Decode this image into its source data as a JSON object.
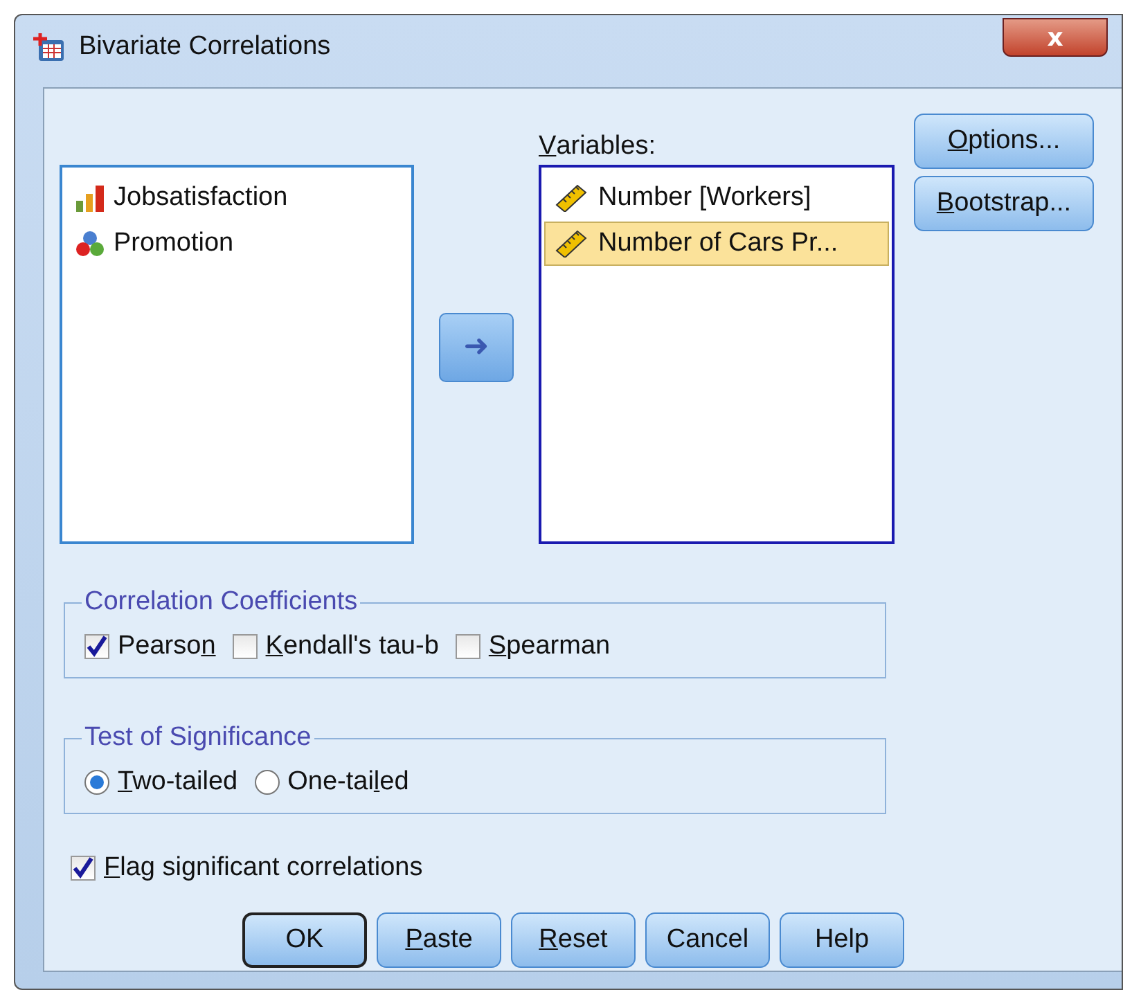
{
  "window": {
    "title": "Bivariate Correlations",
    "close": "x"
  },
  "source_list": {
    "items": [
      {
        "kind": "ordinal",
        "label": "Jobsatisfaction",
        "selected": false
      },
      {
        "kind": "nominal",
        "label": "Promotion",
        "selected": false
      }
    ]
  },
  "move_button": {
    "label": "➜"
  },
  "variables": {
    "label": {
      "key": "V",
      "post": "ariables:"
    },
    "items": [
      {
        "kind": "scale",
        "label": "Number [Workers]",
        "selected": false
      },
      {
        "kind": "scale",
        "label": "Number of Cars Pr...",
        "selected": true
      }
    ]
  },
  "side_buttons": [
    {
      "key": "O",
      "post": "ptions..."
    },
    {
      "key": "B",
      "post": "ootstrap..."
    }
  ],
  "coefficients": {
    "title": "Correlation Coefficients",
    "options": [
      {
        "pre": "Pearso",
        "key": "n",
        "checked": true
      },
      {
        "key": "K",
        "post": "endall's tau-b",
        "checked": false
      },
      {
        "key": "S",
        "post": "pearman",
        "checked": false
      }
    ]
  },
  "significance": {
    "title": "Test of Significance",
    "options": [
      {
        "key": "T",
        "post": "wo-tailed",
        "selected": true
      },
      {
        "pre": "One-tai",
        "key": "l",
        "post": "ed",
        "selected": false
      }
    ]
  },
  "flag": {
    "key": "F",
    "post": "lag significant correlations",
    "checked": true
  },
  "buttons": [
    {
      "pre": "OK",
      "default": true
    },
    {
      "key": "P",
      "post": "aste",
      "default": false
    },
    {
      "key": "R",
      "post": "eset",
      "default": false
    },
    {
      "pre": "Cancel",
      "default": false
    },
    {
      "pre": "Help",
      "default": false
    }
  ]
}
